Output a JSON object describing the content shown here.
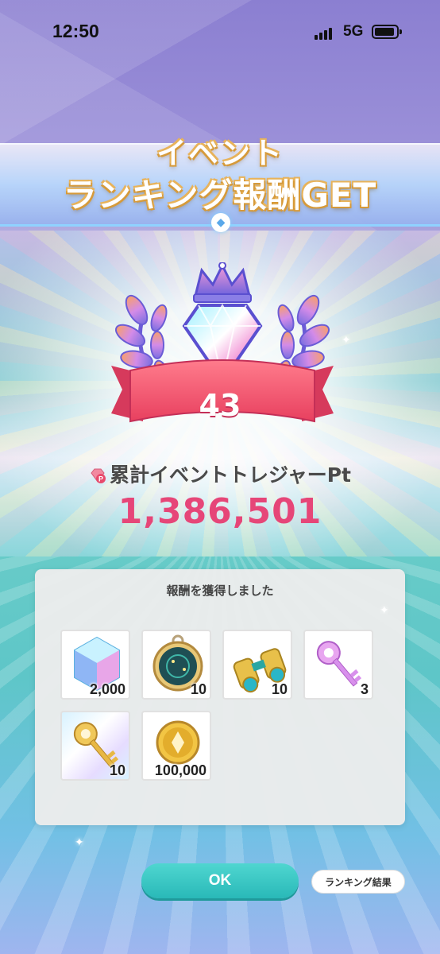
{
  "status_bar": {
    "time": "12:50",
    "network": "5G"
  },
  "header": {
    "title_line1": "イベント",
    "title_line2": "ランキング報酬GET"
  },
  "badge": {
    "rank": "43"
  },
  "points": {
    "label": "累計イベントトレジャーPt",
    "value": "1,386,501",
    "icon": "treasure-pt-icon"
  },
  "rewards": {
    "title": "報酬を獲得しました",
    "items": [
      {
        "name": "crystal",
        "qty": "2,000"
      },
      {
        "name": "pocket-watch",
        "qty": "10"
      },
      {
        "name": "binoculars",
        "qty": "10"
      },
      {
        "name": "pink-key",
        "qty": "3"
      },
      {
        "name": "gold-key",
        "qty": "10"
      },
      {
        "name": "gold-coin",
        "qty": "100,000"
      }
    ]
  },
  "buttons": {
    "ok": "OK",
    "ranking_result": "ランキング結果"
  },
  "colors": {
    "accent": "#e64678",
    "ok_button": "#2fbfbd",
    "ribbon": "#ef4f73"
  }
}
